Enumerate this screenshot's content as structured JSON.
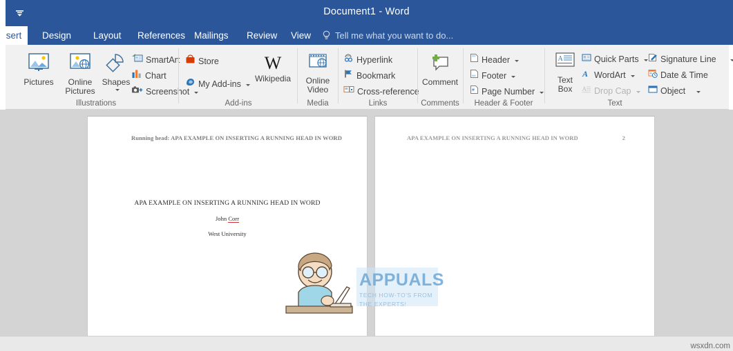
{
  "titlebar": {
    "document_title": "Document1 - Word",
    "qat_icon": "customize-quick-access-toolbar-icon"
  },
  "tabs": [
    {
      "label": "sert",
      "active": true,
      "name": "tab-insert"
    },
    {
      "label": "Design",
      "active": false,
      "name": "tab-design"
    },
    {
      "label": "Layout",
      "active": false,
      "name": "tab-layout"
    },
    {
      "label": "References",
      "active": false,
      "name": "tab-references"
    },
    {
      "label": "Mailings",
      "active": false,
      "name": "tab-mailings"
    },
    {
      "label": "Review",
      "active": false,
      "name": "tab-review"
    },
    {
      "label": "View",
      "active": false,
      "name": "tab-view"
    }
  ],
  "tellme": {
    "label": "Tell me what you want to do...",
    "icon": "lightbulb-icon"
  },
  "ribbon": {
    "groups": [
      {
        "name": "illustrations",
        "label": "Illustrations",
        "big_buttons": [
          {
            "label": "Pictures",
            "icon": "pictures-icon",
            "caret": false
          },
          {
            "label": "Online\nPictures",
            "label_l1": "Online",
            "label_l2": "Pictures",
            "icon": "online-pictures-icon",
            "caret": false
          },
          {
            "label": "Shapes",
            "icon": "shapes-icon",
            "caret": true
          }
        ],
        "small_buttons": [
          {
            "label": "SmartArt",
            "icon": "smartart-icon",
            "caret": false
          },
          {
            "label": "Chart",
            "icon": "chart-icon",
            "caret": false
          },
          {
            "label": "Screenshot",
            "icon": "screenshot-icon",
            "caret": true
          }
        ]
      },
      {
        "name": "addins",
        "label": "Add-ins",
        "big_buttons": [
          {
            "label": "Wikipedia",
            "icon": "wikipedia-icon",
            "caret": false
          }
        ],
        "small_buttons": [
          {
            "label": "Store",
            "icon": "store-icon",
            "caret": false
          },
          {
            "label": "My Add-ins",
            "icon": "my-addins-icon",
            "caret": true
          }
        ]
      },
      {
        "name": "media",
        "label": "Media",
        "big_buttons": [
          {
            "label_l1": "Online",
            "label_l2": "Video",
            "icon": "online-video-icon",
            "caret": false
          }
        ],
        "small_buttons": []
      },
      {
        "name": "links",
        "label": "Links",
        "big_buttons": [],
        "small_buttons": [
          {
            "label": "Hyperlink",
            "icon": "hyperlink-icon",
            "caret": false
          },
          {
            "label": "Bookmark",
            "icon": "bookmark-icon",
            "caret": false
          },
          {
            "label": "Cross-reference",
            "icon": "cross-reference-icon",
            "caret": false
          }
        ]
      },
      {
        "name": "comments",
        "label": "Comments",
        "big_buttons": [
          {
            "label": "Comment",
            "icon": "comment-icon",
            "caret": false
          }
        ],
        "small_buttons": []
      },
      {
        "name": "header-footer",
        "label": "Header & Footer",
        "big_buttons": [],
        "small_buttons": [
          {
            "label": "Header",
            "icon": "header-icon",
            "caret": true
          },
          {
            "label": "Footer",
            "icon": "footer-icon",
            "caret": true
          },
          {
            "label": "Page Number",
            "icon": "page-number-icon",
            "caret": true
          }
        ]
      },
      {
        "name": "text",
        "label": "Text",
        "big_buttons": [
          {
            "label_l1": "Text",
            "label_l2": "Box",
            "icon": "text-box-icon",
            "caret": true
          }
        ],
        "small_buttons": [
          {
            "label": "Quick Parts",
            "icon": "quick-parts-icon",
            "caret": true,
            "disabled": false
          },
          {
            "label": "WordArt",
            "icon": "wordart-icon",
            "caret": true,
            "disabled": false
          },
          {
            "label": "Drop Cap",
            "icon": "drop-cap-icon",
            "caret": true,
            "disabled": true
          },
          {
            "label": "Signature Line",
            "icon": "signature-line-icon",
            "caret": true,
            "disabled": false
          },
          {
            "label": "Date & Time",
            "icon": "date-time-icon",
            "caret": false,
            "disabled": false
          },
          {
            "label": "Object",
            "icon": "object-icon",
            "caret": true,
            "disabled": false
          }
        ]
      }
    ]
  },
  "document": {
    "page1": {
      "header_text": "Running head: APA EXAMPLE ON INSERTING A RUNNING HEAD IN WORD",
      "page_number": "1",
      "title": "APA EXAMPLE ON INSERTING A RUNNING HEAD IN WORD",
      "author": "John ",
      "author_misspelled": "Corr",
      "affiliation": "West University"
    },
    "page2": {
      "header_text": "APA EXAMPLE ON INSERTING A RUNNING HEAD IN WORD",
      "page_number": "2"
    }
  },
  "watermark": {
    "brand": "APPUALS",
    "tagline_line1": "TECH HOW-TO'S FROM",
    "tagline_line2": "THE EXPERTS!",
    "character_icon": "man-at-laptop-illustration"
  },
  "sitemark": {
    "label": "wsxdn.com"
  },
  "colors": {
    "title_bar": "#2b579a",
    "ribbon_bg": "#f1f1f1",
    "doc_background": "#d4d4d4",
    "page": "#ffffff",
    "accent_blue": "#41719c",
    "spellcheck_red": "#d13438",
    "store_red": "#d83b01",
    "chart_blue": "#2e75b6",
    "comment_green": "#70ad47",
    "watermark_blue": "#6ea8d6"
  }
}
